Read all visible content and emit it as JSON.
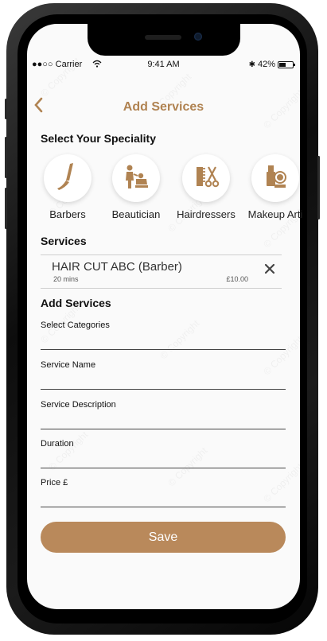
{
  "status_bar": {
    "carrier": "●●○○ Carrier",
    "time": "9:41 AM",
    "battery": "42%"
  },
  "nav": {
    "back_icon": "chevron-left-icon",
    "title": "Add Services"
  },
  "speciality": {
    "heading": "Select Your Speciality",
    "items": [
      {
        "label": "Barbers",
        "icon": "razor-icon"
      },
      {
        "label": "Beautician",
        "icon": "beautician-icon"
      },
      {
        "label": "Hairdressers",
        "icon": "scissors-comb-icon"
      },
      {
        "label": "Makeup Arti",
        "icon": "makeup-icon"
      }
    ]
  },
  "services": {
    "heading": "Services",
    "items": [
      {
        "name": "HAIR CUT ABC (Barber)",
        "duration": "20 mins",
        "price": "£10.00"
      }
    ]
  },
  "add_services": {
    "heading": "Add Services",
    "fields": [
      {
        "label": "Select Categories",
        "value": ""
      },
      {
        "label": "Service Name",
        "value": ""
      },
      {
        "label": "Service Description",
        "value": ""
      },
      {
        "label": "Duration",
        "value": ""
      },
      {
        "label": "Price £",
        "value": ""
      }
    ]
  },
  "save_label": "Save",
  "colors": {
    "accent": "#b08352",
    "button": "#b9895b"
  }
}
